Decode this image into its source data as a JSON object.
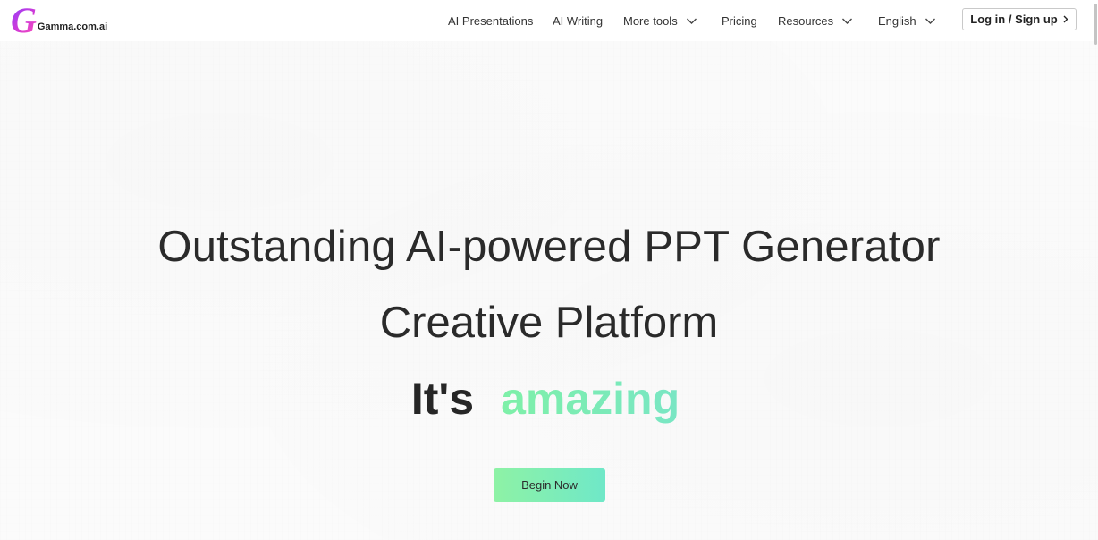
{
  "brand": {
    "logo_letter": "G",
    "name": "Gamma.com.ai"
  },
  "nav": {
    "items": [
      {
        "label": "AI Presentations",
        "has_dropdown": false
      },
      {
        "label": "AI Writing",
        "has_dropdown": false
      },
      {
        "label": "More tools",
        "has_dropdown": true,
        "icon": "chevron-down-icon"
      },
      {
        "label": "Pricing",
        "has_dropdown": false
      },
      {
        "label": "Resources",
        "has_dropdown": true,
        "icon": "chevron-down-icon"
      },
      {
        "label": "English",
        "has_dropdown": true,
        "icon": "chevron-down-icon"
      }
    ],
    "login_label": "Log in / Sign up",
    "login_icon": "chevron-right-icon"
  },
  "hero": {
    "line1": "Outstanding AI-powered PPT Generator",
    "line2": "Creative Platform",
    "line3_prefix": "It's",
    "line3_highlight": "amazing",
    "cta_label": "Begin Now"
  },
  "colors": {
    "logo_gradient": [
      "#8b3dff",
      "#ff4fb8"
    ],
    "accent_green": "#7ef0a8",
    "accent_teal": "#6fe8c8",
    "text_dark": "#2a2a2a"
  }
}
